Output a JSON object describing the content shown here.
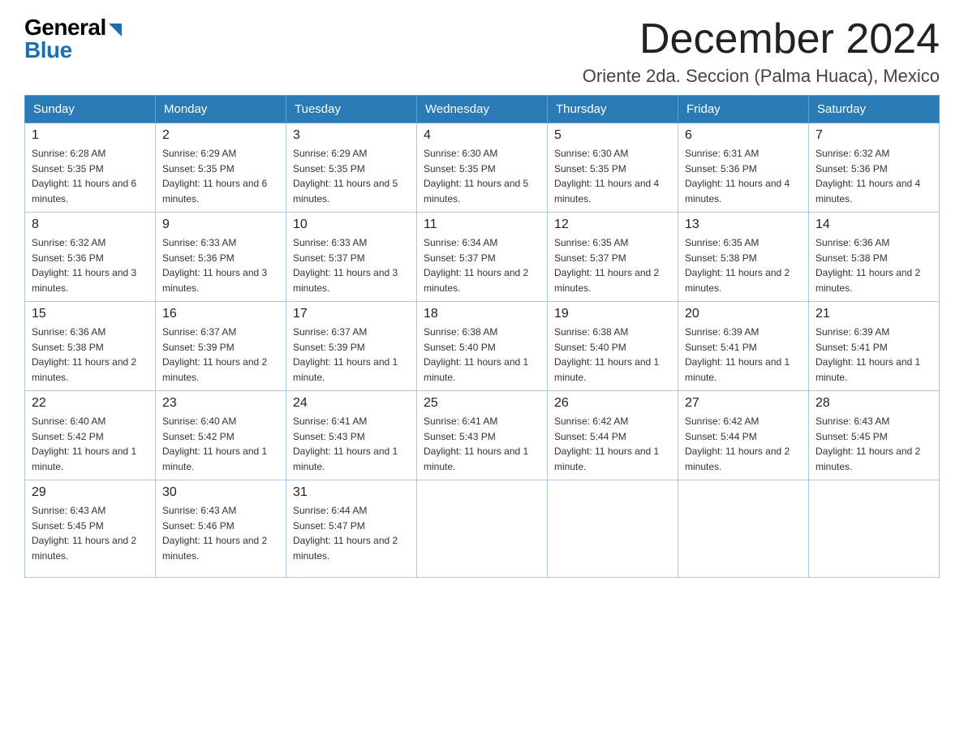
{
  "logo": {
    "general": "General",
    "blue": "Blue"
  },
  "title": {
    "month": "December 2024",
    "location": "Oriente 2da. Seccion (Palma Huaca), Mexico"
  },
  "weekdays": [
    "Sunday",
    "Monday",
    "Tuesday",
    "Wednesday",
    "Thursday",
    "Friday",
    "Saturday"
  ],
  "weeks": [
    [
      {
        "day": "1",
        "sunrise": "6:28 AM",
        "sunset": "5:35 PM",
        "daylight": "11 hours and 6 minutes."
      },
      {
        "day": "2",
        "sunrise": "6:29 AM",
        "sunset": "5:35 PM",
        "daylight": "11 hours and 6 minutes."
      },
      {
        "day": "3",
        "sunrise": "6:29 AM",
        "sunset": "5:35 PM",
        "daylight": "11 hours and 5 minutes."
      },
      {
        "day": "4",
        "sunrise": "6:30 AM",
        "sunset": "5:35 PM",
        "daylight": "11 hours and 5 minutes."
      },
      {
        "day": "5",
        "sunrise": "6:30 AM",
        "sunset": "5:35 PM",
        "daylight": "11 hours and 4 minutes."
      },
      {
        "day": "6",
        "sunrise": "6:31 AM",
        "sunset": "5:36 PM",
        "daylight": "11 hours and 4 minutes."
      },
      {
        "day": "7",
        "sunrise": "6:32 AM",
        "sunset": "5:36 PM",
        "daylight": "11 hours and 4 minutes."
      }
    ],
    [
      {
        "day": "8",
        "sunrise": "6:32 AM",
        "sunset": "5:36 PM",
        "daylight": "11 hours and 3 minutes."
      },
      {
        "day": "9",
        "sunrise": "6:33 AM",
        "sunset": "5:36 PM",
        "daylight": "11 hours and 3 minutes."
      },
      {
        "day": "10",
        "sunrise": "6:33 AM",
        "sunset": "5:37 PM",
        "daylight": "11 hours and 3 minutes."
      },
      {
        "day": "11",
        "sunrise": "6:34 AM",
        "sunset": "5:37 PM",
        "daylight": "11 hours and 2 minutes."
      },
      {
        "day": "12",
        "sunrise": "6:35 AM",
        "sunset": "5:37 PM",
        "daylight": "11 hours and 2 minutes."
      },
      {
        "day": "13",
        "sunrise": "6:35 AM",
        "sunset": "5:38 PM",
        "daylight": "11 hours and 2 minutes."
      },
      {
        "day": "14",
        "sunrise": "6:36 AM",
        "sunset": "5:38 PM",
        "daylight": "11 hours and 2 minutes."
      }
    ],
    [
      {
        "day": "15",
        "sunrise": "6:36 AM",
        "sunset": "5:38 PM",
        "daylight": "11 hours and 2 minutes."
      },
      {
        "day": "16",
        "sunrise": "6:37 AM",
        "sunset": "5:39 PM",
        "daylight": "11 hours and 2 minutes."
      },
      {
        "day": "17",
        "sunrise": "6:37 AM",
        "sunset": "5:39 PM",
        "daylight": "11 hours and 1 minute."
      },
      {
        "day": "18",
        "sunrise": "6:38 AM",
        "sunset": "5:40 PM",
        "daylight": "11 hours and 1 minute."
      },
      {
        "day": "19",
        "sunrise": "6:38 AM",
        "sunset": "5:40 PM",
        "daylight": "11 hours and 1 minute."
      },
      {
        "day": "20",
        "sunrise": "6:39 AM",
        "sunset": "5:41 PM",
        "daylight": "11 hours and 1 minute."
      },
      {
        "day": "21",
        "sunrise": "6:39 AM",
        "sunset": "5:41 PM",
        "daylight": "11 hours and 1 minute."
      }
    ],
    [
      {
        "day": "22",
        "sunrise": "6:40 AM",
        "sunset": "5:42 PM",
        "daylight": "11 hours and 1 minute."
      },
      {
        "day": "23",
        "sunrise": "6:40 AM",
        "sunset": "5:42 PM",
        "daylight": "11 hours and 1 minute."
      },
      {
        "day": "24",
        "sunrise": "6:41 AM",
        "sunset": "5:43 PM",
        "daylight": "11 hours and 1 minute."
      },
      {
        "day": "25",
        "sunrise": "6:41 AM",
        "sunset": "5:43 PM",
        "daylight": "11 hours and 1 minute."
      },
      {
        "day": "26",
        "sunrise": "6:42 AM",
        "sunset": "5:44 PM",
        "daylight": "11 hours and 1 minute."
      },
      {
        "day": "27",
        "sunrise": "6:42 AM",
        "sunset": "5:44 PM",
        "daylight": "11 hours and 2 minutes."
      },
      {
        "day": "28",
        "sunrise": "6:43 AM",
        "sunset": "5:45 PM",
        "daylight": "11 hours and 2 minutes."
      }
    ],
    [
      {
        "day": "29",
        "sunrise": "6:43 AM",
        "sunset": "5:45 PM",
        "daylight": "11 hours and 2 minutes."
      },
      {
        "day": "30",
        "sunrise": "6:43 AM",
        "sunset": "5:46 PM",
        "daylight": "11 hours and 2 minutes."
      },
      {
        "day": "31",
        "sunrise": "6:44 AM",
        "sunset": "5:47 PM",
        "daylight": "11 hours and 2 minutes."
      },
      null,
      null,
      null,
      null
    ]
  ]
}
